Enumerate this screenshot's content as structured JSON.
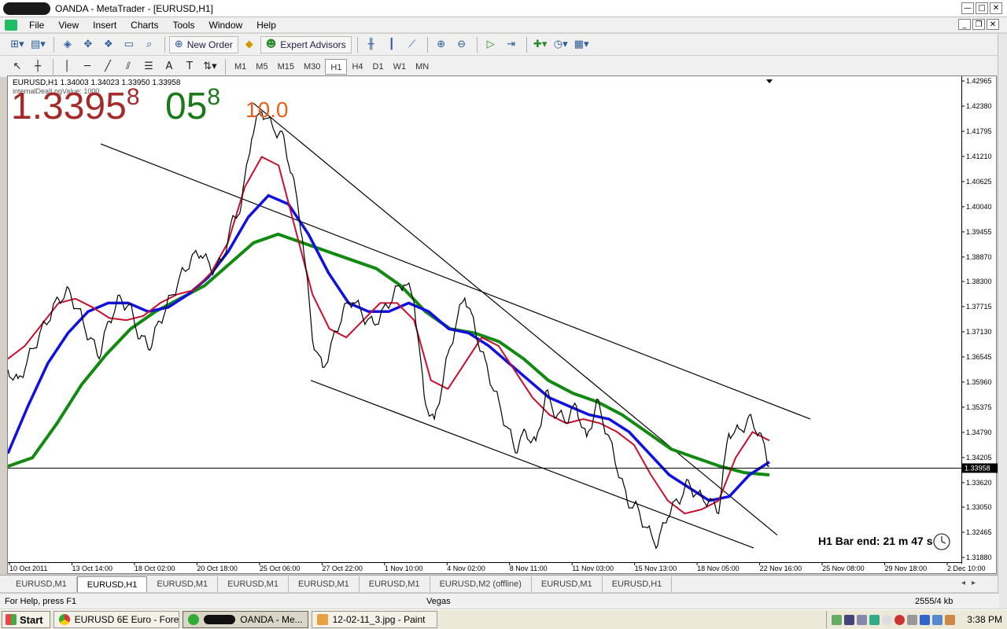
{
  "window": {
    "title": "OANDA - MetaTrader - [EURUSD,H1]",
    "minimize": "—",
    "maximize": "□",
    "close": "✕",
    "mdi_minimize": "_",
    "mdi_restore": "❐",
    "mdi_close": "✕"
  },
  "menu": [
    "File",
    "View",
    "Insert",
    "Charts",
    "Tools",
    "Window",
    "Help"
  ],
  "toolbar": {
    "new_order": "New Order",
    "expert_advisors": "Expert Advisors"
  },
  "timeframes": [
    "M1",
    "M5",
    "M15",
    "M30",
    "H1",
    "H4",
    "D1",
    "W1",
    "MN"
  ],
  "active_timeframe": "H1",
  "chart": {
    "header": "EURUSD,H1  1.34003 1.34023 1.33950 1.33958",
    "indicator_label": "internalDealLogValue: 1000",
    "big_bid": "1.3395",
    "big_bid_sup": "8",
    "big_ask": "05",
    "big_ask_sup": "8",
    "spread": "10.0",
    "bar_end": "H1 Bar end: 21 m 47 s",
    "current_price": "1.33958",
    "colors": {
      "price": "#000000",
      "ma_fast": "#c8102e",
      "ma_mid": "#1010e0",
      "ma_slow": "#128a12",
      "big_bid": "#a52a2a",
      "big_ask": "#1a7a1a",
      "spread": "#e8601c"
    }
  },
  "chart_data": {
    "type": "line",
    "y_ticks": [
      "1.42965",
      "1.42380",
      "1.41795",
      "1.41210",
      "1.40625",
      "1.40040",
      "1.39455",
      "1.38870",
      "1.38300",
      "1.37715",
      "1.37130",
      "1.36545",
      "1.35960",
      "1.35375",
      "1.34790",
      "1.34205",
      "1.33620",
      "1.33050",
      "1.32465",
      "1.31880"
    ],
    "x_ticks": [
      "10 Oct 2011",
      "13 Oct 14:00",
      "18 Oct 02:00",
      "20 Oct 18:00",
      "25 Oct 06:00",
      "27 Oct 22:00",
      "1 Nov 10:00",
      "4 Nov 02:00",
      "8 Nov 11:00",
      "11 Nov 03:00",
      "15 Nov 13:00",
      "18 Nov 05:00",
      "22 Nov 16:00",
      "25 Nov 08:00",
      "29 Nov 18:00",
      "2 Dec 10:00"
    ],
    "ylim": [
      1.3188,
      1.42965
    ],
    "current_price": 1.33958,
    "price": [
      1.3625,
      1.3595,
      1.365,
      1.37,
      1.3745,
      1.379,
      1.3805,
      1.376,
      1.37,
      1.366,
      1.374,
      1.379,
      1.377,
      1.37,
      1.368,
      1.374,
      1.379,
      1.384,
      1.388,
      1.39,
      1.386,
      1.387,
      1.396,
      1.401,
      1.417,
      1.423,
      1.419,
      1.417,
      1.408,
      1.394,
      1.37,
      1.3625,
      1.369,
      1.376,
      1.379,
      1.375,
      1.373,
      1.376,
      1.38,
      1.383,
      1.379,
      1.356,
      1.35,
      1.362,
      1.372,
      1.38,
      1.372,
      1.364,
      1.357,
      1.35,
      1.344,
      1.348,
      1.345,
      1.357,
      1.352,
      1.351,
      1.354,
      1.346,
      1.355,
      1.348,
      1.34,
      1.332,
      1.33,
      1.325,
      1.322,
      1.329,
      1.332,
      1.336,
      1.333,
      1.332,
      1.33,
      1.348,
      1.348,
      1.351,
      1.348,
      1.34
    ],
    "series": [
      {
        "values": [
          1.365,
          1.368,
          1.373,
          1.378,
          1.379,
          1.377,
          1.3745,
          1.374,
          1.375,
          1.378,
          1.38,
          1.381,
          1.385,
          1.392,
          1.405,
          1.412,
          1.41,
          1.395,
          1.38,
          1.372,
          1.37,
          1.374,
          1.378,
          1.378,
          1.374,
          1.36,
          1.358,
          1.364,
          1.37,
          1.368,
          1.362,
          1.356,
          1.352,
          1.35,
          1.351,
          1.35,
          1.348,
          1.345,
          1.338,
          1.332,
          1.329,
          1.33,
          1.332,
          1.342,
          1.348,
          1.346
        ]
      },
      {
        "values": [
          1.343,
          1.354,
          1.364,
          1.371,
          1.376,
          1.378,
          1.378,
          1.376,
          1.377,
          1.38,
          1.384,
          1.39,
          1.398,
          1.403,
          1.401,
          1.394,
          1.385,
          1.378,
          1.376,
          1.376,
          1.378,
          1.376,
          1.372,
          1.371,
          1.368,
          1.364,
          1.36,
          1.356,
          1.354,
          1.352,
          1.351,
          1.348,
          1.343,
          1.338,
          1.335,
          1.332,
          1.333,
          1.338,
          1.341
        ]
      },
      {
        "values": [
          1.34,
          1.342,
          1.35,
          1.359,
          1.366,
          1.372,
          1.376,
          1.379,
          1.382,
          1.387,
          1.392,
          1.394,
          1.392,
          1.39,
          1.388,
          1.386,
          1.382,
          1.376,
          1.372,
          1.371,
          1.369,
          1.365,
          1.36,
          1.357,
          1.355,
          1.352,
          1.348,
          1.344,
          1.342,
          1.34,
          1.3385,
          1.338
        ]
      }
    ],
    "trendlines": [
      {
        "from": [
          "start",
          1.415
        ],
        "to": [
          "end",
          1.351
        ]
      },
      {
        "from": [
          "27 Oct",
          1.4245
        ],
        "to": [
          "2 Dec",
          1.324
        ]
      },
      {
        "from": [
          "1 Nov",
          1.36
        ],
        "to": [
          "2 Dec",
          1.321
        ]
      }
    ]
  },
  "tabs": [
    "EURUSD,M1",
    "EURUSD,H1",
    "EURUSD,M1",
    "EURUSD,M1",
    "EURUSD,M1",
    "EURUSD,M1",
    "EURUSD,M2 (offline)",
    "EURUSD,M1",
    "EURUSD,H1"
  ],
  "active_tab": 1,
  "status": {
    "help": "For Help, press F1",
    "profile": "Vegas",
    "traffic": "2555/4 kb"
  },
  "taskbar": {
    "start": "Start",
    "items": [
      "EURUSD 6E Euro - Fore...",
      "OANDA - Me...",
      "12-02-11_3.jpg - Paint"
    ],
    "clock": "3:38 PM"
  }
}
